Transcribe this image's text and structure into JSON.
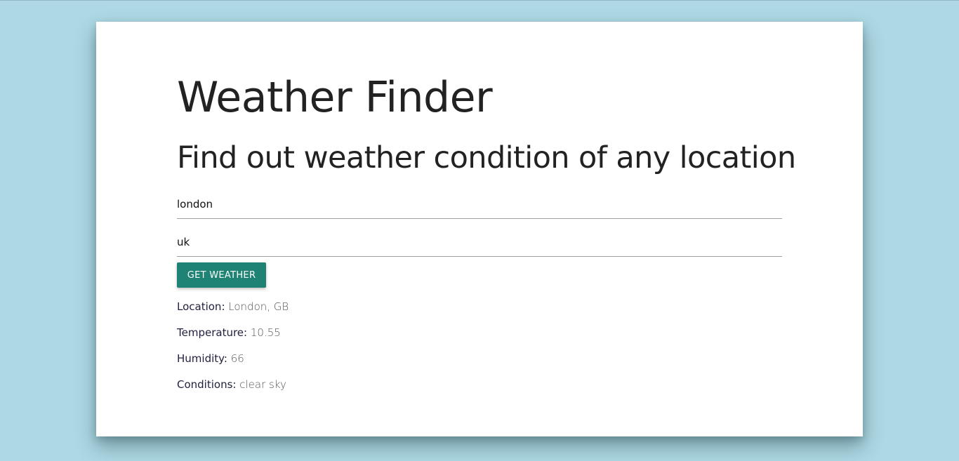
{
  "header": {
    "title": "Weather Finder",
    "subtitle": "Find out weather condition of any location"
  },
  "form": {
    "city_value": "london",
    "country_value": "uk",
    "submit_label": "GET WEATHER"
  },
  "results": {
    "location_label": "Location:",
    "location_value": "London, GB",
    "temperature_label": "Temperature:",
    "temperature_value": "10.55",
    "humidity_label": "Humidity:",
    "humidity_value": "66",
    "conditions_label": "Conditions:",
    "conditions_value": "clear sky"
  },
  "colors": {
    "background": "#add8e4",
    "card": "#ffffff",
    "button": "#1e8374",
    "text": "#222222"
  }
}
